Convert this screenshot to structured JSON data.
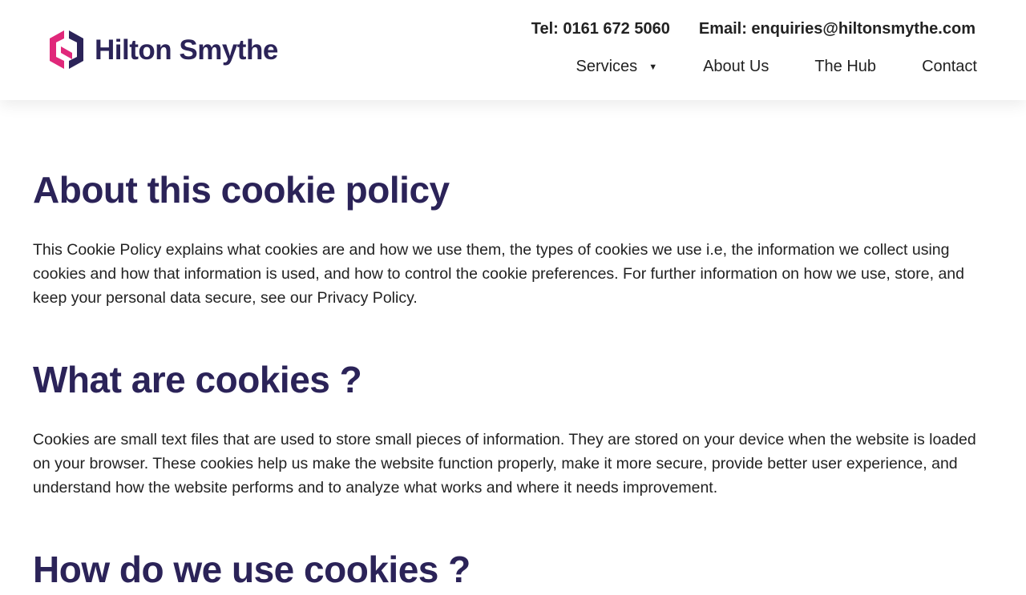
{
  "brand": {
    "name": "Hilton Smythe",
    "colors": {
      "primary": "#2b2358",
      "accent": "#e0287a"
    }
  },
  "header": {
    "tel": "Tel: 0161 672 5060",
    "email": "Email: enquiries@hiltonsmythe.com",
    "nav": [
      {
        "label": "Services",
        "icon": "caret-down-icon",
        "caret": "▼"
      },
      {
        "label": "About Us"
      },
      {
        "label": "The Hub"
      },
      {
        "label": "Contact"
      }
    ]
  },
  "sections": [
    {
      "title": "About this cookie policy",
      "body": "This Cookie Policy explains what cookies are and how we use them, the types of cookies we use i.e, the information we collect using cookies and how that information is used, and how to control the cookie preferences. For further information on how we use, store, and keep your personal data secure, see our Privacy Policy."
    },
    {
      "title": "What are cookies ?",
      "body": "Cookies are small text files that are used to store small pieces of information. They are stored on your device when the website is loaded on your browser. These cookies help us make the website function properly, make it more secure, provide better user experience, and understand how the website performs and to analyze what works and where it needs improvement."
    },
    {
      "title": "How do we use cookies ?"
    }
  ]
}
